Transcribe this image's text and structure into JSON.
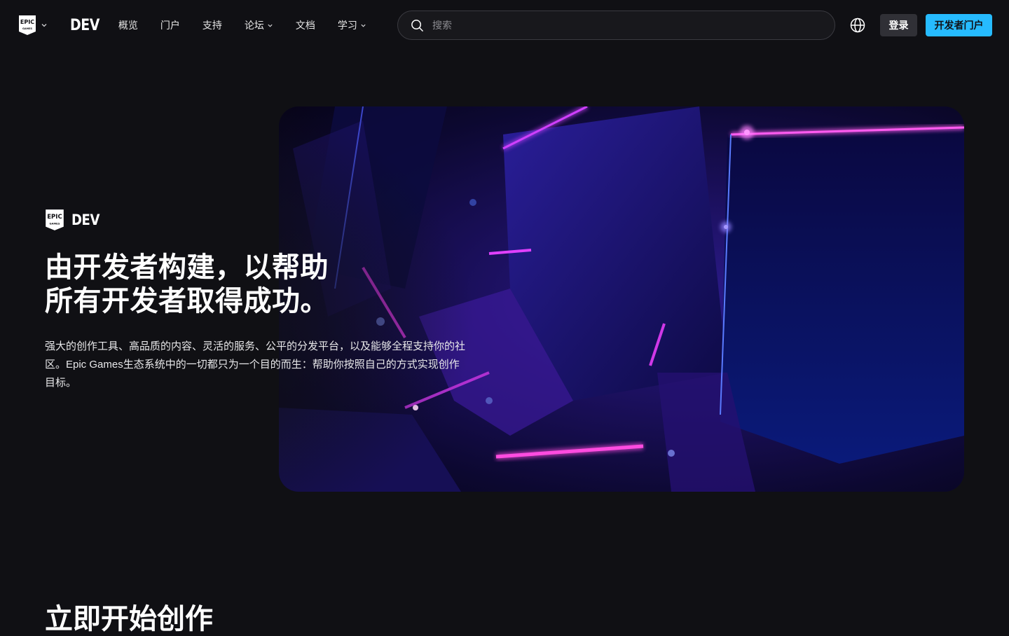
{
  "header": {
    "brand_dev": "DEV",
    "nav": [
      {
        "label": "概览",
        "has_dropdown": false
      },
      {
        "label": "门户",
        "has_dropdown": false
      },
      {
        "label": "支持",
        "has_dropdown": false
      },
      {
        "label": "论坛",
        "has_dropdown": true
      },
      {
        "label": "文档",
        "has_dropdown": false
      },
      {
        "label": "学习",
        "has_dropdown": true
      }
    ],
    "search_placeholder": "搜索",
    "login_label": "登录",
    "portal_label": "开发者门户"
  },
  "hero": {
    "brand_dev": "DEV",
    "title_line1": "由开发者构建，以帮助",
    "title_line2": "所有开发者取得成功。",
    "description": "强大的创作工具、高品质的内容、灵活的服务、公平的分发平台，以及能够全程支持你的社区。Epic Games生态系统中的一切都只为一个目的而生：帮助你按照自己的方式实现创作目标。"
  },
  "section": {
    "title": "立即开始创作"
  },
  "colors": {
    "background": "#101014",
    "accent": "#26bbff",
    "login_bg": "#303036"
  },
  "icons": {
    "logo": "epic-games-shield-icon",
    "search": "search-icon",
    "language": "globe-icon",
    "dropdown": "chevron-down-icon"
  }
}
